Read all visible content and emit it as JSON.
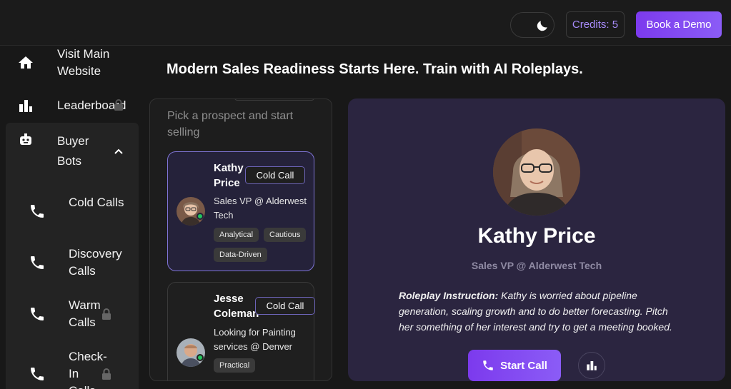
{
  "header": {
    "credits_label": "Credits: 5",
    "book_demo_label": "Book a Demo"
  },
  "sidebar": {
    "items": [
      {
        "label": "Visit Main Website",
        "icon": "home-icon"
      },
      {
        "label": "Leaderboard",
        "icon": "bar-chart-icon"
      },
      {
        "label": "Buyer Bots",
        "icon": "robot-icon"
      }
    ],
    "sub_items": [
      {
        "label": "Cold Calls",
        "icon": "phone-icon"
      },
      {
        "label": "Discovery Calls",
        "icon": "phone-icon"
      },
      {
        "label": "Warm Calls",
        "icon": "phone-icon"
      },
      {
        "label": "Check-In Calls",
        "icon": "phone-icon"
      }
    ]
  },
  "main": {
    "title": "Modern Sales Readiness Starts Here. Train with AI Roleplays.",
    "list_hint": "Pick a prospect and start selling"
  },
  "prospects": [
    {
      "name": "Kathy Price",
      "badge": "Cold Call",
      "role": "Sales VP @ Alderwest Tech",
      "tags": [
        "Analytical",
        "Cautious",
        "Data-Driven"
      ]
    },
    {
      "name": "Jesse Coleman",
      "badge": "Cold Call",
      "role": "Looking for Painting services @ Denver",
      "tags": [
        "Practical"
      ]
    }
  ],
  "detail": {
    "name": "Kathy Price",
    "role": "Sales VP @ Alderwest Tech",
    "instruction_label": "Roleplay Instruction:",
    "instruction_text": " Kathy is worried about pipeline generation, scaling growth and to do better forecasting. Pitch her something of her interest and try to get a meeting booked.",
    "start_call_label": "Start Call"
  },
  "colors": {
    "accent": "#8b5cf6",
    "credits_text": "#a78bfa",
    "detail_bg": "#2b2540",
    "online": "#22c55e"
  }
}
